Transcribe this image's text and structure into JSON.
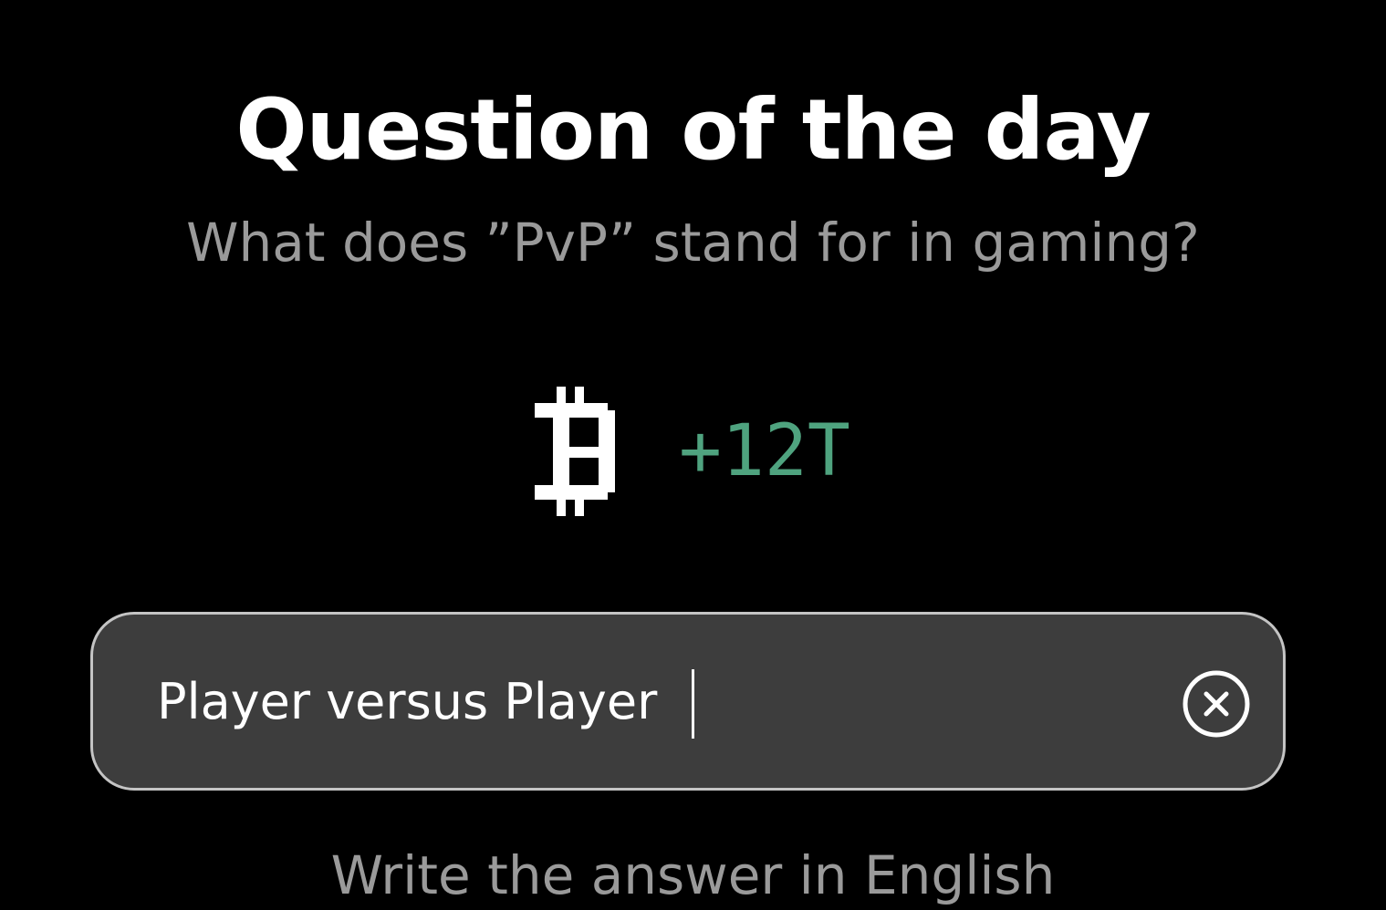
{
  "header": {
    "title": "Question of the day",
    "question": "What does ”PvP” stand for in gaming?"
  },
  "reward": {
    "icon": "pixel-coin-icon",
    "amount": "+12T",
    "accent_color": "#4fa37f"
  },
  "answer": {
    "value": "Player versus Player",
    "clear_icon": "close-circle-icon"
  },
  "hint": {
    "text": "Write the answer in English"
  }
}
